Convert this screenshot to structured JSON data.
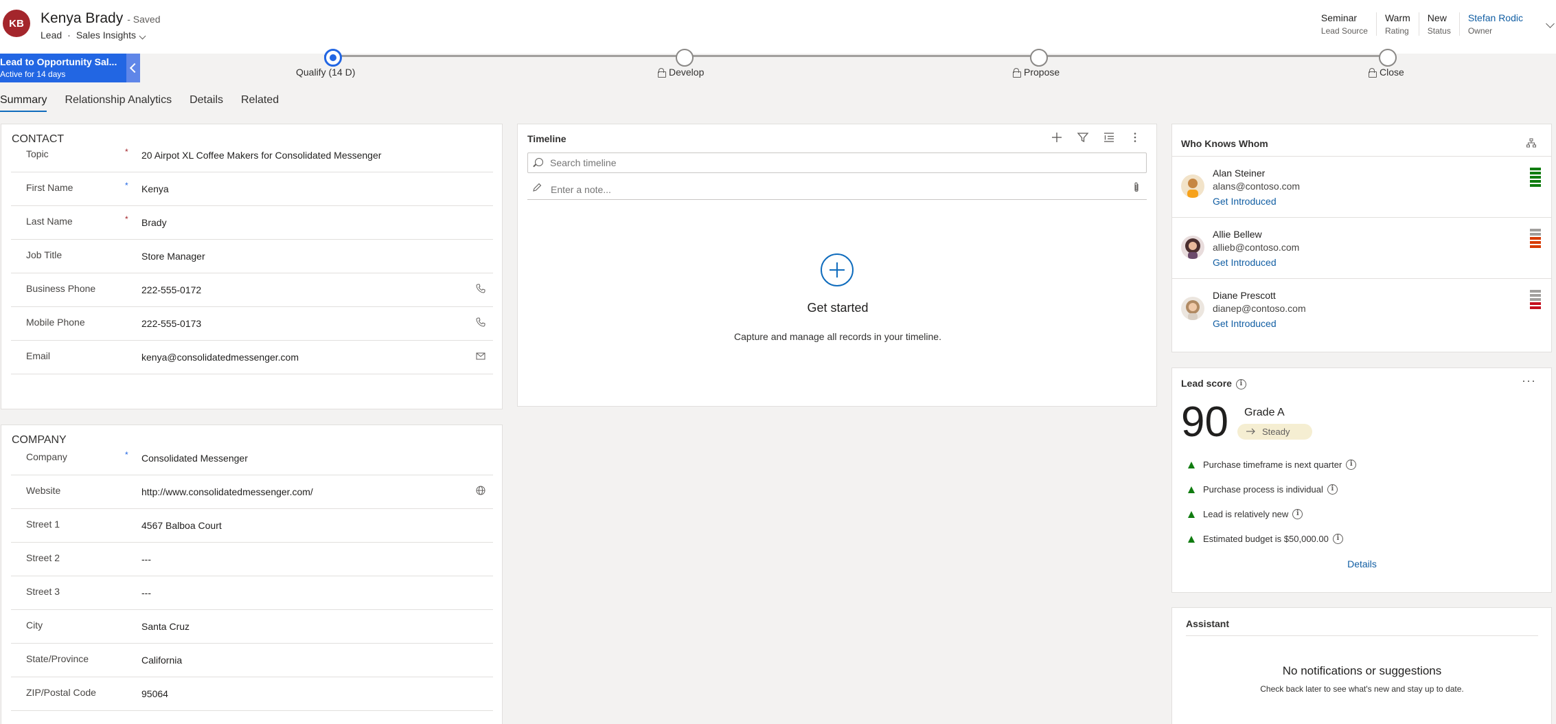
{
  "header": {
    "initials": "KB",
    "title": "Kenya Brady",
    "saved": "- Saved",
    "entity": "Lead",
    "separator": "·",
    "form": "Sales Insights",
    "fields": [
      {
        "value": "Seminar",
        "label": "Lead Source",
        "link": false
      },
      {
        "value": "Warm",
        "label": "Rating",
        "link": false
      },
      {
        "value": "New",
        "label": "Status",
        "link": false
      },
      {
        "value": "Stefan Rodic",
        "label": "Owner",
        "link": true
      }
    ]
  },
  "bpf": {
    "process_name": "Lead to Opportunity Sal...",
    "active_for": "Active for 14 days",
    "stages": [
      {
        "label": "Qualify  (14 D)",
        "active": true,
        "locked": false
      },
      {
        "label": "Develop",
        "active": false,
        "locked": true
      },
      {
        "label": "Propose",
        "active": false,
        "locked": true
      },
      {
        "label": "Close",
        "active": false,
        "locked": true
      }
    ]
  },
  "tabs": [
    "Summary",
    "Relationship Analytics",
    "Details",
    "Related"
  ],
  "contact": {
    "title": "CONTACT",
    "fields": [
      {
        "label": "Topic",
        "value": "20 Airpot XL Coffee Makers for Consolidated Messenger",
        "req": "*",
        "icon": ""
      },
      {
        "label": "First Name",
        "value": "Kenya",
        "req": "*",
        "icon": ""
      },
      {
        "label": "Last Name",
        "value": "Brady",
        "req": "*",
        "icon": ""
      },
      {
        "label": "Job Title",
        "value": "Store Manager",
        "req": "",
        "icon": ""
      },
      {
        "label": "Business Phone",
        "value": "222-555-0172",
        "req": "",
        "icon": "phone-icon"
      },
      {
        "label": "Mobile Phone",
        "value": "222-555-0173",
        "req": "",
        "icon": "phone-icon"
      },
      {
        "label": "Email",
        "value": "kenya@consolidatedmessenger.com",
        "req": "",
        "icon": "email-icon"
      }
    ]
  },
  "company": {
    "title": "COMPANY",
    "fields": [
      {
        "label": "Company",
        "value": "Consolidated Messenger",
        "req": "*",
        "icon": ""
      },
      {
        "label": "Website",
        "value": "http://www.consolidatedmessenger.com/",
        "req": "",
        "icon": "globe-icon"
      },
      {
        "label": "Street 1",
        "value": "4567 Balboa Court",
        "req": "",
        "icon": ""
      },
      {
        "label": "Street 2",
        "value": "---",
        "req": "",
        "icon": ""
      },
      {
        "label": "Street 3",
        "value": "---",
        "req": "",
        "icon": ""
      },
      {
        "label": "City",
        "value": "Santa Cruz",
        "req": "",
        "icon": ""
      },
      {
        "label": "State/Province",
        "value": "California",
        "req": "",
        "icon": ""
      },
      {
        "label": "ZIP/Postal Code",
        "value": "95064",
        "req": "",
        "icon": ""
      }
    ]
  },
  "timeline": {
    "title": "Timeline",
    "search_placeholder": "Search timeline",
    "note_placeholder": "Enter a note...",
    "empty_title": "Get started",
    "empty_sub": "Capture and manage all records in your timeline."
  },
  "who_knows": {
    "title": "Who Knows Whom",
    "people": [
      {
        "name": "Alan Steiner",
        "email": "alans@contoso.com",
        "action": "Get Introduced",
        "strength": 5,
        "strength_color": "#107c10"
      },
      {
        "name": "Allie Bellew",
        "email": "allieb@contoso.com",
        "action": "Get Introduced",
        "strength": 3,
        "strength_color": "#d83b01"
      },
      {
        "name": "Diane Prescott",
        "email": "dianep@contoso.com",
        "action": "Get Introduced",
        "strength": 2,
        "strength_color": "#c50f1f"
      }
    ]
  },
  "lead_score": {
    "title": "Lead score",
    "score": "90",
    "grade": "Grade A",
    "trend": "Steady",
    "reasons": [
      "Purchase timeframe is next quarter",
      "Purchase process is individual",
      "Lead is relatively new",
      "Estimated budget is $50,000.00"
    ],
    "details_link": "Details"
  },
  "assistant": {
    "title": "Assistant",
    "heading": "No notifications or suggestions",
    "sub": "Check back later to see what's new and stay up to date."
  },
  "colors": {
    "accent": "#2266e3",
    "link": "#115ea3",
    "avatar": "#a4262c",
    "positive": "#107c10"
  }
}
